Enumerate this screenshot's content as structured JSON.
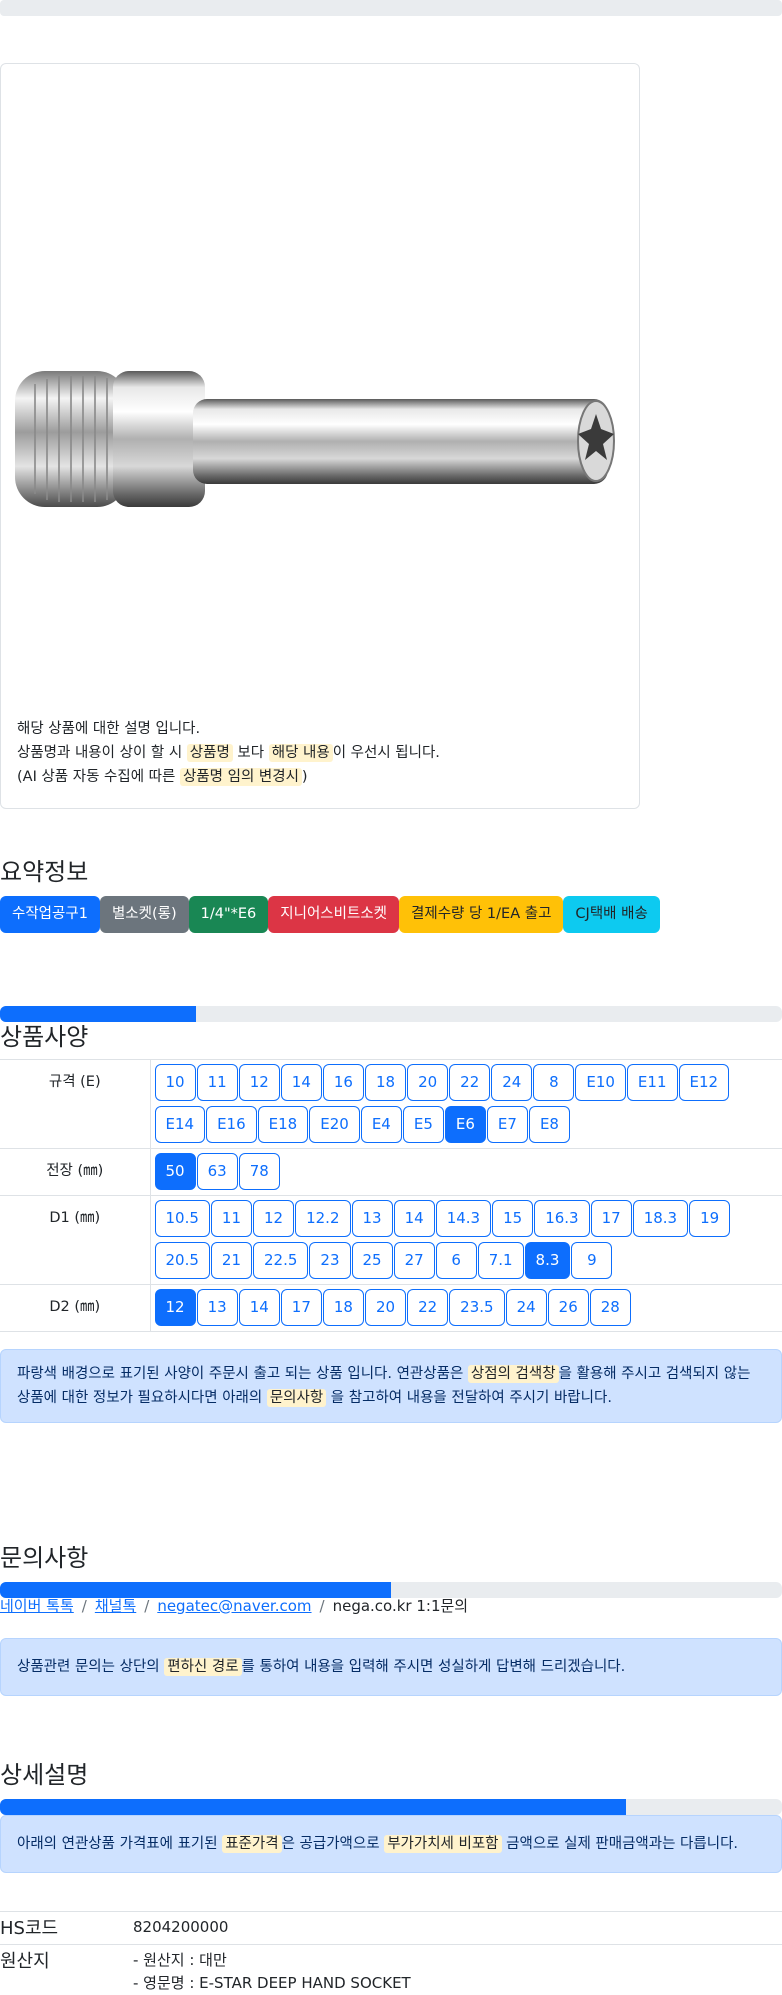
{
  "product": {
    "desc_line1": "해당 상품에 대한 설명 입니다.",
    "desc_line2_a": "상품명과 내용이 상이 할 시 ",
    "desc_line2_hl1": "상품명",
    "desc_line2_b": " 보다 ",
    "desc_line2_hl2": "해당 내용",
    "desc_line2_c": "이 우선시 됩니다.",
    "desc_line3_a": "(AI 상품 자동 수집에 따른 ",
    "desc_line3_hl": "상품명 임의 변경시",
    "desc_line3_b": ")"
  },
  "summary": {
    "title": "요약정보",
    "badges": [
      {
        "label": "수작업공구1",
        "color": "#0d6efd",
        "text": "#ffffff"
      },
      {
        "label": "별소켓(롱)",
        "color": "#6c757d",
        "text": "#ffffff"
      },
      {
        "label": "1/4\"*E6",
        "color": "#198754",
        "text": "#ffffff"
      },
      {
        "label": "지니어스비트소켓",
        "color": "#dc3545",
        "text": "#ffffff"
      },
      {
        "label": "결제수량 당 1/EA 출고",
        "color": "#ffc107",
        "text": "#212529"
      },
      {
        "label": "CJ택배 배송",
        "color": "#0dcaf0",
        "text": "#212529"
      }
    ]
  },
  "spec": {
    "title": "상품사양",
    "progress": 0.25,
    "rows": [
      {
        "label": "규격 (E)",
        "options": [
          "10",
          "11",
          "12",
          "14",
          "16",
          "18",
          "20",
          "22",
          "24",
          "8",
          "E10",
          "E11",
          "E12",
          "E14",
          "E16",
          "E18",
          "E20",
          "E4",
          "E5",
          "E6",
          "E7",
          "E8"
        ],
        "active": "E6"
      },
      {
        "label": "전장 (㎜)",
        "options": [
          "50",
          "63",
          "78"
        ],
        "active": "50"
      },
      {
        "label": "D1 (㎜)",
        "options": [
          "10.5",
          "11",
          "12",
          "12.2",
          "13",
          "14",
          "14.3",
          "15",
          "16.3",
          "17",
          "18.3",
          "19",
          "20.5",
          "21",
          "22.5",
          "23",
          "25",
          "27",
          "6",
          "7.1",
          "8.3",
          "9"
        ],
        "active": "8.3"
      },
      {
        "label": "D2 (㎜)",
        "options": [
          "12",
          "13",
          "14",
          "17",
          "18",
          "20",
          "22",
          "23.5",
          "24",
          "26",
          "28"
        ],
        "active": "12"
      }
    ],
    "notice_a": "파랑색 배경으로 표기된 사양이 주문시 출고 되는 상품 입니다. 연관상품은 ",
    "notice_hl1": "상점의 검색창",
    "notice_b": "을 활용해 주시고 검색되지 않는 상품에 대한 정보가 필요하시다면 아래의 ",
    "notice_hl2": "문의사항",
    "notice_c": " 을 참고하여 내용을 전달하여 주시기 바랍니다."
  },
  "inquiry": {
    "title": "문의사항",
    "progress": 0.5,
    "links": [
      "네이버 톡톡",
      "채널톡",
      "negatec@naver.com"
    ],
    "current": "nega.co.kr 1:1문의",
    "notice_a": "상품관련 문의는 상단의 ",
    "notice_hl": "편하신 경로",
    "notice_b": "를 통하여 내용을 입력해 주시면 성실하게 답변해 드리겠습니다."
  },
  "detail": {
    "title": "상세설명",
    "progress": 0.8,
    "notice_a": "아래의 연관상품 가격표에 표기된 ",
    "notice_hl1": "표준가격",
    "notice_b": "은 공급가액으로 ",
    "notice_hl2": "부가가치세 비포함",
    "notice_c": " 금액으로 실제 판매금액과는 다릅니다."
  },
  "info": {
    "hs_label": "HS코드",
    "hs_value": "8204200000",
    "origin_label": "원산지",
    "origin_line1": "- 원산지 : 대만",
    "origin_line2": "- 영문명 : E-STAR DEEP HAND SOCKET"
  }
}
